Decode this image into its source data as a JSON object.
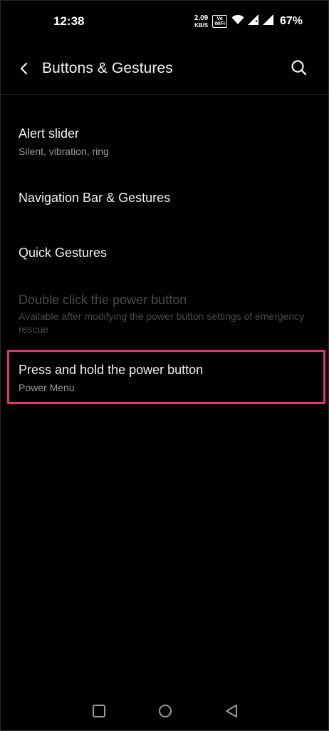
{
  "status": {
    "time": "12:38",
    "net_speed_value": "2.09",
    "net_speed_unit": "KB/S",
    "volte_line1": "Vo",
    "volte_line2": "WiFi",
    "battery": "67%"
  },
  "header": {
    "title": "Buttons & Gestures"
  },
  "items": [
    {
      "title": "Alert slider",
      "subtitle": "Silent, vibration, ring"
    },
    {
      "title": "Navigation Bar & Gestures"
    },
    {
      "title": "Quick Gestures"
    },
    {
      "title": "Double click the power button",
      "subtitle": "Available after modifying the power button settings of emergency rescue"
    },
    {
      "title": "Press and hold the power button",
      "subtitle": "Power Menu"
    }
  ],
  "colors": {
    "background": "#000000",
    "highlight": "#e8326e",
    "disabled_text": "#4a4a4a"
  }
}
